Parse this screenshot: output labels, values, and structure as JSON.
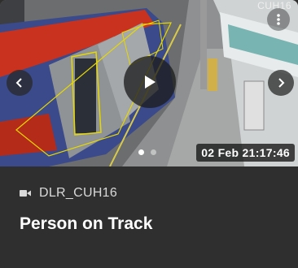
{
  "media": {
    "camera_id_overlay": "CUH16",
    "timestamp": "02 Feb 21:17:46",
    "carousel": {
      "count": 2,
      "active_index": 0
    }
  },
  "icons": {
    "menu": "more-vert-icon",
    "prev": "chevron-left-icon",
    "next": "chevron-right-icon",
    "play": "play-icon",
    "camera": "videocam-icon"
  },
  "info": {
    "camera_name": "DLR_CUH16",
    "event_title": "Person on Track"
  },
  "colors": {
    "card_background": "#2f2f2f",
    "detection_box": "#e6d800",
    "train_red": "#c8321e",
    "train_blue": "#1f3f9a"
  }
}
